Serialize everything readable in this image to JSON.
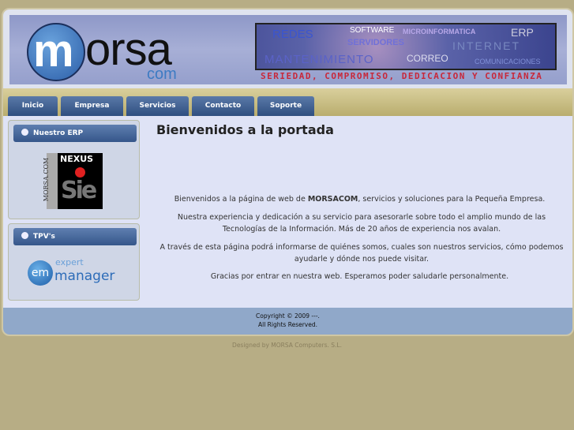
{
  "header": {
    "logo_text": "morsa",
    "logo_sub": "com",
    "services": [
      "REDES",
      "SOFTWARE",
      "MICROINFORMATICA",
      "ERP",
      "SERVIDORES",
      "INTERNET",
      "MANTENIMIENTO",
      "CORREO",
      "COMUNICACIONES"
    ],
    "tagline": "SERIEDAD, COMPROMISO, DEDICACION Y CONFIANZA"
  },
  "nav": [
    "Inicio",
    "Empresa",
    "Servicios",
    "Contacto",
    "Soporte"
  ],
  "sidebar": [
    {
      "title": "Nuestro ERP",
      "image_text": [
        "NEXUS",
        "Sie",
        "MORSA.COM"
      ]
    },
    {
      "title": "TPV's",
      "image_text": [
        "em",
        "expert",
        "manager"
      ]
    }
  ],
  "main": {
    "title": "Bienvenidos a la portada",
    "p1_pre": "Bienvenidos a la página de web de ",
    "p1_bold": "MORSACOM",
    "p1_post": ", servicios y soluciones para la Pequeña Empresa.",
    "p2": "Nuestra experiencia y dedicación a su servicio para asesorarle sobre todo el amplio mundo de las Tecnologías de la Información. Más de 20 años de experiencia nos avalan.",
    "p3": "A través de esta página podrá informarse de quiénes somos, cuales son nuestros servicios, cómo podemos ayudarle y dónde nos puede visitar.",
    "p4": "Gracias por entrar en nuestra web. Esperamos poder saludarle personalmente."
  },
  "footer": {
    "copyright": "Copyright © 2009 ---.",
    "rights": "All Rights Reserved."
  },
  "designed_by": "Designed by MORSA Computers. S.L."
}
